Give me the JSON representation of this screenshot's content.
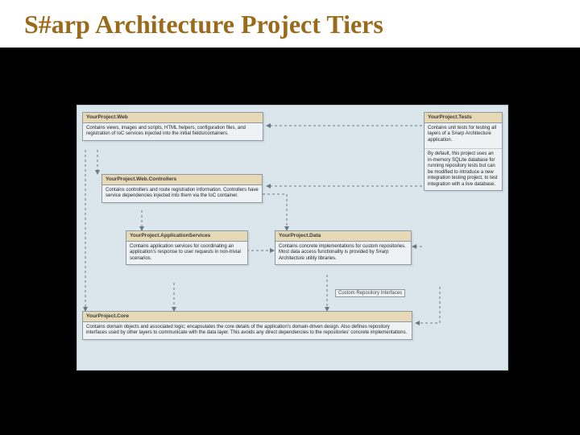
{
  "title": "S#arp Architecture Project Tiers",
  "boxes": {
    "web": {
      "title": "YourProject.Web",
      "body": "Contains views, images and scripts, HTML helpers, configuration files, and registration of IoC services injected into the initial fields/containers."
    },
    "tests": {
      "title": "YourProject.Tests",
      "body": "Contains unit tests for testing all layers of a S#arp Architecture application.",
      "body2": "By default, this project uses an in-memory SQLite database for running repository tests but can be modified to introduce a new integration testing project, to test integration with a live database."
    },
    "controllers": {
      "title": "YourProject.Web.Controllers",
      "body": "Contains controllers and route registration information. Controllers have service dependencies injected into them via the IoC container."
    },
    "appservices": {
      "title": "YourProject.ApplicationServices",
      "body": "Contains application services for coordinating an application's response to user requests in non-trivial scenarios."
    },
    "data": {
      "title": "YourProject.Data",
      "body": "Contains concrete implementations for custom repositories. Most data access functionality is provided by S#arp Architecture utility libraries."
    },
    "core": {
      "title": "YourProject.Core",
      "body": "Contains domain objects and associated logic; encapsulates the core details of the application's domain-driven design. Also defines repository interfaces used by other layers to communicate with the data layer. This avoids any direct dependencies to the repositories' concrete implementations."
    }
  },
  "labels": {
    "custom_repo": "Custom Repository Interfaces"
  }
}
